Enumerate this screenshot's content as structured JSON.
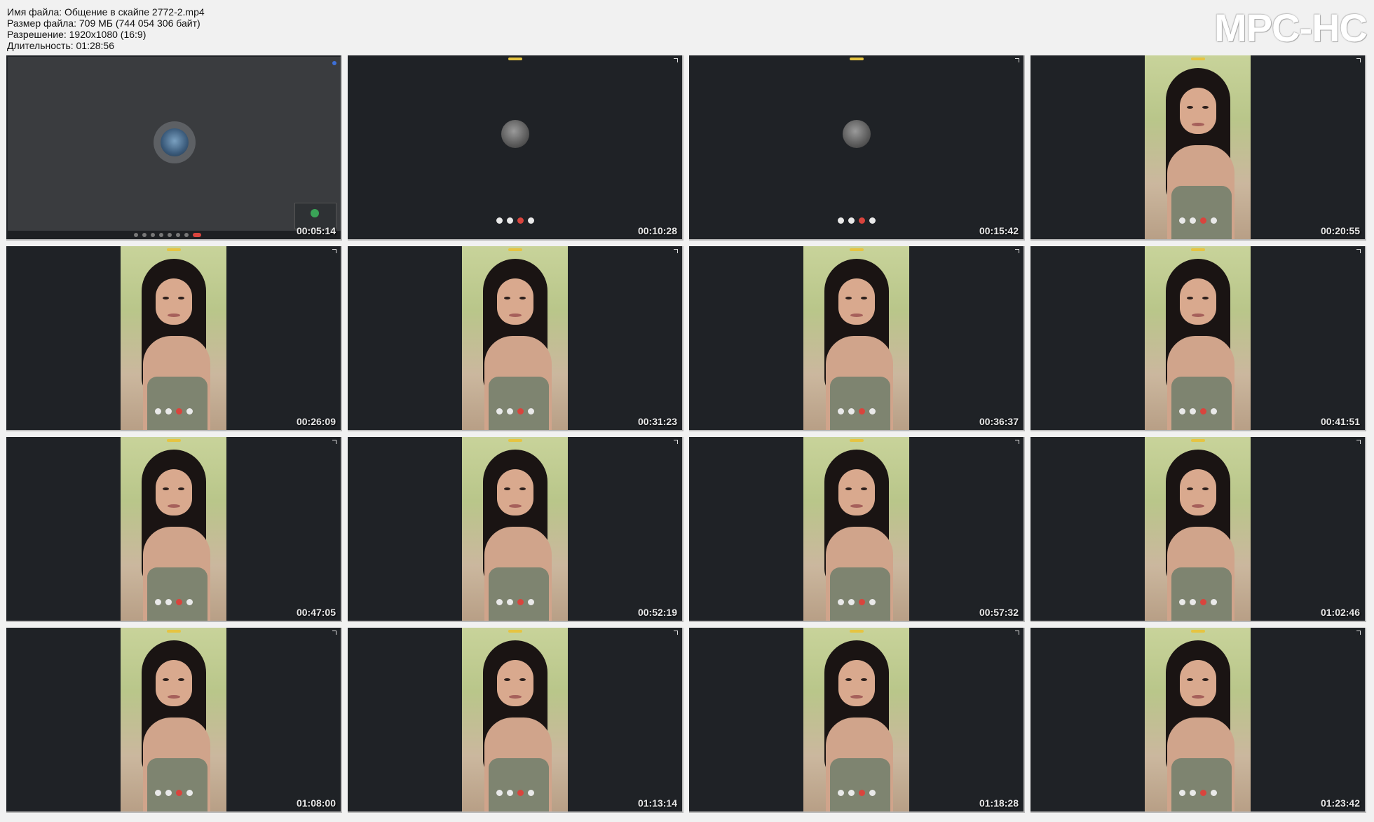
{
  "header": {
    "filename": "Имя файла: Общение в скайпе 2772-2.mp4",
    "filesize": "Размер файла: 709 МБ (744 054 306 байт)",
    "resolution": "Разрешение: 1920x1080 (16:9)",
    "duration": "Длительность: 01:28:56"
  },
  "logo": "MPC-HC",
  "thumbnails": [
    {
      "time": "00:05:14",
      "kind": "desktop"
    },
    {
      "time": "00:10:28",
      "kind": "calling"
    },
    {
      "time": "00:15:42",
      "kind": "calling"
    },
    {
      "time": "00:20:55",
      "kind": "video"
    },
    {
      "time": "00:26:09",
      "kind": "video"
    },
    {
      "time": "00:31:23",
      "kind": "video"
    },
    {
      "time": "00:36:37",
      "kind": "video"
    },
    {
      "time": "00:41:51",
      "kind": "video"
    },
    {
      "time": "00:47:05",
      "kind": "video"
    },
    {
      "time": "00:52:19",
      "kind": "video"
    },
    {
      "time": "00:57:32",
      "kind": "video"
    },
    {
      "time": "01:02:46",
      "kind": "video"
    },
    {
      "time": "01:08:00",
      "kind": "video"
    },
    {
      "time": "01:13:14",
      "kind": "video"
    },
    {
      "time": "01:18:28",
      "kind": "video"
    },
    {
      "time": "01:23:42",
      "kind": "video"
    }
  ],
  "colors": {
    "page_bg": "#f1f1f1",
    "frame_bg": "#1f2226",
    "end_call_red": "#d9443d"
  }
}
